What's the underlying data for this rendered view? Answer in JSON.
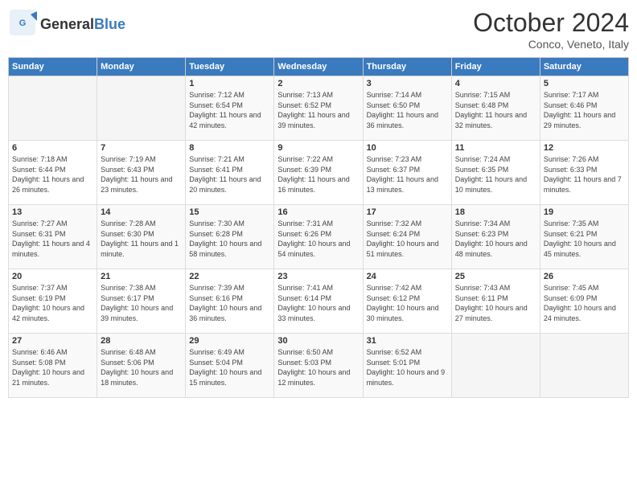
{
  "logo": {
    "text_general": "General",
    "text_blue": "Blue"
  },
  "header": {
    "month": "October 2024",
    "location": "Conco, Veneto, Italy"
  },
  "days_of_week": [
    "Sunday",
    "Monday",
    "Tuesday",
    "Wednesday",
    "Thursday",
    "Friday",
    "Saturday"
  ],
  "weeks": [
    [
      {
        "day": "",
        "sunrise": "",
        "sunset": "",
        "daylight": ""
      },
      {
        "day": "",
        "sunrise": "",
        "sunset": "",
        "daylight": ""
      },
      {
        "day": "1",
        "sunrise": "Sunrise: 7:12 AM",
        "sunset": "Sunset: 6:54 PM",
        "daylight": "Daylight: 11 hours and 42 minutes."
      },
      {
        "day": "2",
        "sunrise": "Sunrise: 7:13 AM",
        "sunset": "Sunset: 6:52 PM",
        "daylight": "Daylight: 11 hours and 39 minutes."
      },
      {
        "day": "3",
        "sunrise": "Sunrise: 7:14 AM",
        "sunset": "Sunset: 6:50 PM",
        "daylight": "Daylight: 11 hours and 36 minutes."
      },
      {
        "day": "4",
        "sunrise": "Sunrise: 7:15 AM",
        "sunset": "Sunset: 6:48 PM",
        "daylight": "Daylight: 11 hours and 32 minutes."
      },
      {
        "day": "5",
        "sunrise": "Sunrise: 7:17 AM",
        "sunset": "Sunset: 6:46 PM",
        "daylight": "Daylight: 11 hours and 29 minutes."
      }
    ],
    [
      {
        "day": "6",
        "sunrise": "Sunrise: 7:18 AM",
        "sunset": "Sunset: 6:44 PM",
        "daylight": "Daylight: 11 hours and 26 minutes."
      },
      {
        "day": "7",
        "sunrise": "Sunrise: 7:19 AM",
        "sunset": "Sunset: 6:43 PM",
        "daylight": "Daylight: 11 hours and 23 minutes."
      },
      {
        "day": "8",
        "sunrise": "Sunrise: 7:21 AM",
        "sunset": "Sunset: 6:41 PM",
        "daylight": "Daylight: 11 hours and 20 minutes."
      },
      {
        "day": "9",
        "sunrise": "Sunrise: 7:22 AM",
        "sunset": "Sunset: 6:39 PM",
        "daylight": "Daylight: 11 hours and 16 minutes."
      },
      {
        "day": "10",
        "sunrise": "Sunrise: 7:23 AM",
        "sunset": "Sunset: 6:37 PM",
        "daylight": "Daylight: 11 hours and 13 minutes."
      },
      {
        "day": "11",
        "sunrise": "Sunrise: 7:24 AM",
        "sunset": "Sunset: 6:35 PM",
        "daylight": "Daylight: 11 hours and 10 minutes."
      },
      {
        "day": "12",
        "sunrise": "Sunrise: 7:26 AM",
        "sunset": "Sunset: 6:33 PM",
        "daylight": "Daylight: 11 hours and 7 minutes."
      }
    ],
    [
      {
        "day": "13",
        "sunrise": "Sunrise: 7:27 AM",
        "sunset": "Sunset: 6:31 PM",
        "daylight": "Daylight: 11 hours and 4 minutes."
      },
      {
        "day": "14",
        "sunrise": "Sunrise: 7:28 AM",
        "sunset": "Sunset: 6:30 PM",
        "daylight": "Daylight: 11 hours and 1 minute."
      },
      {
        "day": "15",
        "sunrise": "Sunrise: 7:30 AM",
        "sunset": "Sunset: 6:28 PM",
        "daylight": "Daylight: 10 hours and 58 minutes."
      },
      {
        "day": "16",
        "sunrise": "Sunrise: 7:31 AM",
        "sunset": "Sunset: 6:26 PM",
        "daylight": "Daylight: 10 hours and 54 minutes."
      },
      {
        "day": "17",
        "sunrise": "Sunrise: 7:32 AM",
        "sunset": "Sunset: 6:24 PM",
        "daylight": "Daylight: 10 hours and 51 minutes."
      },
      {
        "day": "18",
        "sunrise": "Sunrise: 7:34 AM",
        "sunset": "Sunset: 6:23 PM",
        "daylight": "Daylight: 10 hours and 48 minutes."
      },
      {
        "day": "19",
        "sunrise": "Sunrise: 7:35 AM",
        "sunset": "Sunset: 6:21 PM",
        "daylight": "Daylight: 10 hours and 45 minutes."
      }
    ],
    [
      {
        "day": "20",
        "sunrise": "Sunrise: 7:37 AM",
        "sunset": "Sunset: 6:19 PM",
        "daylight": "Daylight: 10 hours and 42 minutes."
      },
      {
        "day": "21",
        "sunrise": "Sunrise: 7:38 AM",
        "sunset": "Sunset: 6:17 PM",
        "daylight": "Daylight: 10 hours and 39 minutes."
      },
      {
        "day": "22",
        "sunrise": "Sunrise: 7:39 AM",
        "sunset": "Sunset: 6:16 PM",
        "daylight": "Daylight: 10 hours and 36 minutes."
      },
      {
        "day": "23",
        "sunrise": "Sunrise: 7:41 AM",
        "sunset": "Sunset: 6:14 PM",
        "daylight": "Daylight: 10 hours and 33 minutes."
      },
      {
        "day": "24",
        "sunrise": "Sunrise: 7:42 AM",
        "sunset": "Sunset: 6:12 PM",
        "daylight": "Daylight: 10 hours and 30 minutes."
      },
      {
        "day": "25",
        "sunrise": "Sunrise: 7:43 AM",
        "sunset": "Sunset: 6:11 PM",
        "daylight": "Daylight: 10 hours and 27 minutes."
      },
      {
        "day": "26",
        "sunrise": "Sunrise: 7:45 AM",
        "sunset": "Sunset: 6:09 PM",
        "daylight": "Daylight: 10 hours and 24 minutes."
      }
    ],
    [
      {
        "day": "27",
        "sunrise": "Sunrise: 6:46 AM",
        "sunset": "Sunset: 5:08 PM",
        "daylight": "Daylight: 10 hours and 21 minutes."
      },
      {
        "day": "28",
        "sunrise": "Sunrise: 6:48 AM",
        "sunset": "Sunset: 5:06 PM",
        "daylight": "Daylight: 10 hours and 18 minutes."
      },
      {
        "day": "29",
        "sunrise": "Sunrise: 6:49 AM",
        "sunset": "Sunset: 5:04 PM",
        "daylight": "Daylight: 10 hours and 15 minutes."
      },
      {
        "day": "30",
        "sunrise": "Sunrise: 6:50 AM",
        "sunset": "Sunset: 5:03 PM",
        "daylight": "Daylight: 10 hours and 12 minutes."
      },
      {
        "day": "31",
        "sunrise": "Sunrise: 6:52 AM",
        "sunset": "Sunset: 5:01 PM",
        "daylight": "Daylight: 10 hours and 9 minutes."
      },
      {
        "day": "",
        "sunrise": "",
        "sunset": "",
        "daylight": ""
      },
      {
        "day": "",
        "sunrise": "",
        "sunset": "",
        "daylight": ""
      }
    ]
  ]
}
